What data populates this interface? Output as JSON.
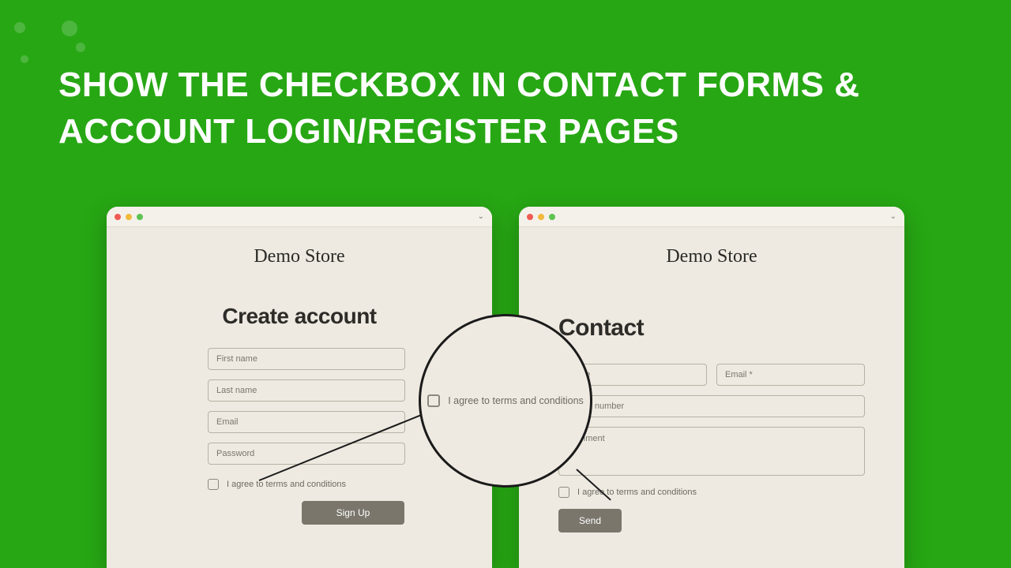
{
  "headline": "SHOW THE CHECKBOX IN CONTACT FORMS & ACCOUNT LOGIN/REGISTER PAGES",
  "store_name": "Demo Store",
  "create": {
    "heading": "Create account",
    "first_name_ph": "First name",
    "last_name_ph": "Last name",
    "email_ph": "Email",
    "password_ph": "Password",
    "consent": "I agree to terms and conditions",
    "submit": "Sign Up"
  },
  "contact": {
    "heading": "Contact",
    "name_ph": "Name",
    "email_ph": "Email *",
    "phone_ph": "Phone number",
    "comment_ph": "Comment",
    "consent": "I agree to terms and conditions",
    "submit": "Send"
  },
  "magnifier_text": "I agree to terms and conditions"
}
